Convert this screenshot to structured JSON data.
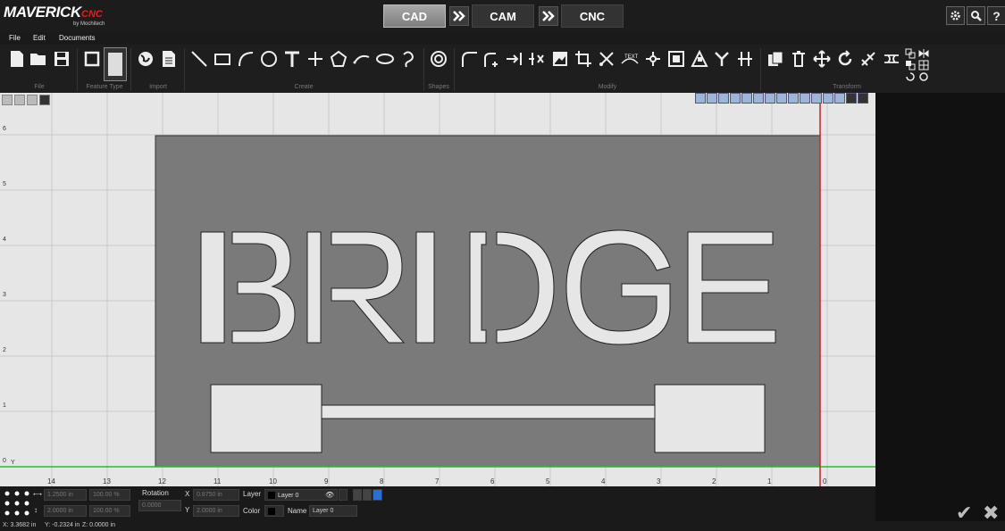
{
  "app": {
    "logo_main": "MAVERICK",
    "logo_suffix": "CNC",
    "logo_by": "by Mochitech"
  },
  "modes": [
    {
      "label": "CAD",
      "active": true
    },
    {
      "label": "CAM",
      "active": false
    },
    {
      "label": "CNC",
      "active": false
    }
  ],
  "menu": [
    "File",
    "Edit",
    "Documents"
  ],
  "ribbon_groups": [
    "File",
    "Feature Type",
    "Import",
    "Create",
    "Shapes",
    "Modify",
    "Transform"
  ],
  "drawing_text": "BRIDGE",
  "y_ticks": [
    "6",
    "5",
    "4",
    "3",
    "2",
    "1",
    "0"
  ],
  "y_axis_label": "Y",
  "x_ticks": [
    "14",
    "13",
    "12",
    "11",
    "10",
    "9",
    "8",
    "7",
    "6",
    "5",
    "4",
    "3",
    "2",
    "1",
    "0"
  ],
  "bottom": {
    "width_value": "1.2500 in",
    "width_pct": "100.00 %",
    "height_value": "2.0000 in",
    "height_pct": "100.00 %",
    "rotation_label": "Rotation",
    "rotation_value": "0.0000",
    "x_label": "X",
    "x_value": "0.8750 in",
    "y_label": "Y",
    "y_value": "2.0000 in",
    "layer_label": "Layer",
    "layer_value": "Layer 0",
    "color_label": "Color",
    "name_label": "Name",
    "name_value": "Layer 0"
  },
  "status": {
    "x": "X: 3.3682 in",
    "y": "Y: -0.2324 in",
    "z": "Z: 0.0000 in"
  },
  "colors": {
    "accent_active": "#8f8f8f",
    "canvas_bg": "#e6e6e6",
    "stock": "#7a7a7a",
    "x_axis": "#22c022",
    "y_axis": "#cc2222"
  }
}
